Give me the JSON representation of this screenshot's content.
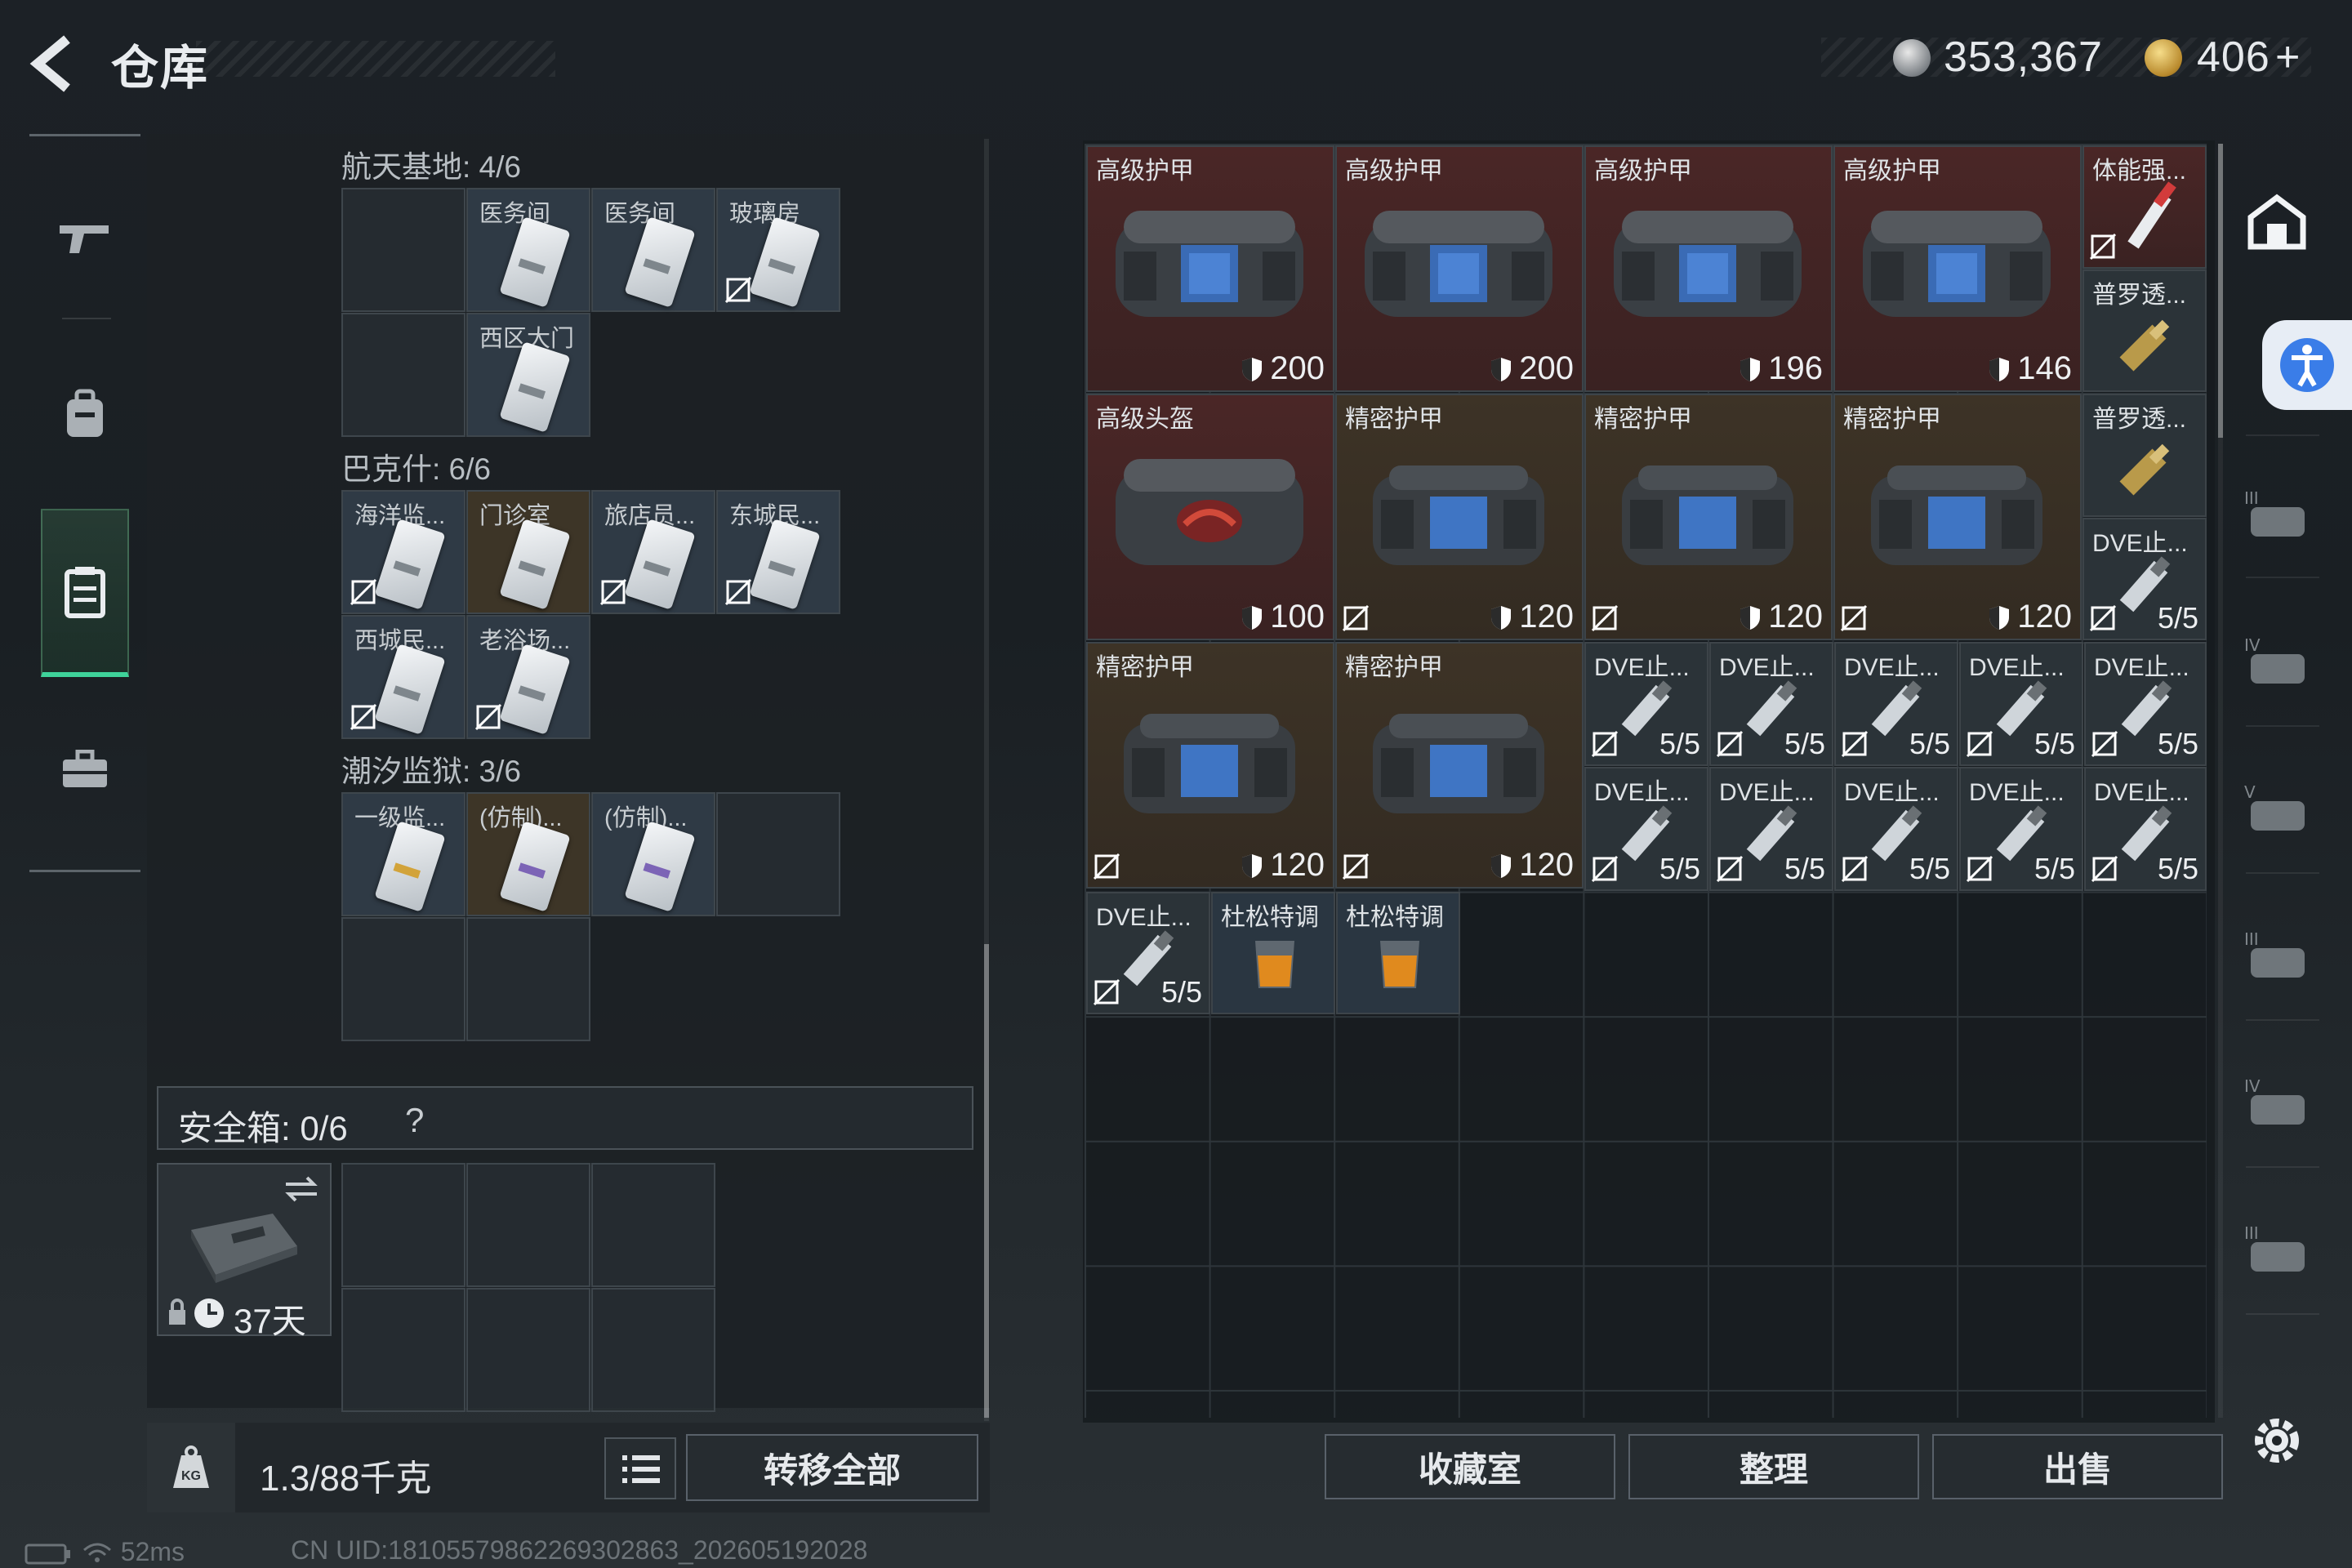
{
  "header": {
    "title": "仓库",
    "silver_amount": "353,367",
    "gold_amount": "406",
    "gold_plus": "+"
  },
  "left_nav": [
    "gun-icon",
    "backpack-icon",
    "storage-icon",
    "briefcase-icon"
  ],
  "left_panel": {
    "groups": [
      {
        "title": "航天基地: 4/6"
      },
      {
        "title": "巴克什: 6/6"
      },
      {
        "title": "潮汐监狱: 3/6"
      }
    ],
    "keys": {
      "g1": [
        "医务间",
        "医务间",
        "玻璃房",
        "西区大门"
      ],
      "g2": [
        "海洋监...",
        "门诊室",
        "旅店员...",
        "东城民...",
        "西城民...",
        "老浴场..."
      ],
      "g3": [
        "一级监...",
        "(仿制)...",
        "(仿制)..."
      ]
    },
    "safe_box": {
      "title": "安全箱: 0/6",
      "help": "?",
      "days": "37天"
    },
    "weight": "1.3/88千克",
    "transfer_all": "转移全部"
  },
  "right_panel": {
    "items": {
      "a1": {
        "label": "高级护甲",
        "durability": "200"
      },
      "a2": {
        "label": "高级护甲",
        "durability": "200"
      },
      "a3": {
        "label": "高级护甲",
        "durability": "196"
      },
      "a4": {
        "label": "高级护甲",
        "durability": "146"
      },
      "h1": {
        "label": "高级头盔",
        "durability": "100"
      },
      "p1": {
        "label": "精密护甲",
        "durability": "120"
      },
      "p2": {
        "label": "精密护甲",
        "durability": "120"
      },
      "p3": {
        "label": "精密护甲",
        "durability": "120"
      },
      "p4": {
        "label": "精密护甲",
        "durability": "120"
      },
      "p5": {
        "label": "精密护甲",
        "durability": "120"
      },
      "s1": {
        "label": "体能强..."
      },
      "s2": {
        "label": "普罗透..."
      },
      "s3": {
        "label": "普罗透..."
      },
      "d_label": "DVE止...",
      "d_stack": "5/5",
      "drink": "杜松特调"
    },
    "buttons": {
      "collection": "收藏室",
      "sort": "整理",
      "sell": "出售"
    }
  },
  "right_nav": [
    "shop-icon",
    "armor-iv-icon",
    "armor-iii-icon",
    "helmet-iv-icon",
    "helmet-v-icon",
    "helmet-iii-icon",
    "bag-iv-icon",
    "bag-iii-icon"
  ],
  "status": {
    "ping": "52ms",
    "uid": "CN UID:18105579862269302863_202605192028"
  }
}
